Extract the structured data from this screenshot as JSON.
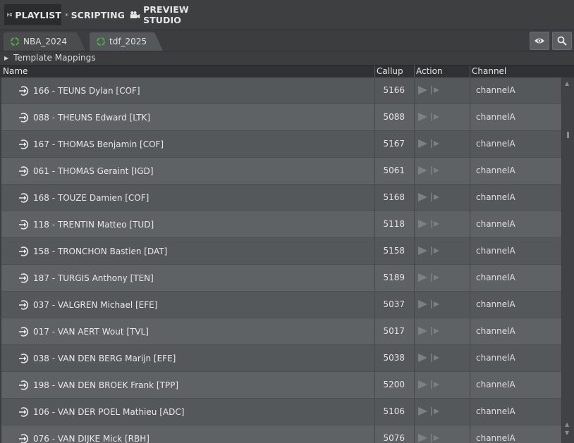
{
  "topbar": {
    "playlist_label": "PLAYLIST",
    "scripting_label": "SCRIPTING",
    "preview_label": "PREVIEW STUDIO"
  },
  "tabs": [
    {
      "label": "NBA_2024"
    },
    {
      "label": "tdf_2025"
    }
  ],
  "toolbar": {
    "eye_icon": "eye-icon",
    "search_icon": "search-icon"
  },
  "mappings": {
    "label": "Template Mappings"
  },
  "columns": {
    "name": "Name",
    "callup": "Callup",
    "action": "Action",
    "channel": "Channel"
  },
  "rows": [
    {
      "name": "166 - TEUNS Dylan  [COF]",
      "callup": "5166",
      "channel": "channelA"
    },
    {
      "name": "088 - THEUNS Edward  [LTK]",
      "callup": "5088",
      "channel": "channelA"
    },
    {
      "name": "167 - THOMAS Benjamin  [COF]",
      "callup": "5167",
      "channel": "channelA"
    },
    {
      "name": "061 - THOMAS Geraint  [IGD]",
      "callup": "5061",
      "channel": "channelA"
    },
    {
      "name": "168 - TOUZE Damien  [COF]",
      "callup": "5168",
      "channel": "channelA"
    },
    {
      "name": "118 - TRENTIN Matteo  [TUD]",
      "callup": "5118",
      "channel": "channelA"
    },
    {
      "name": "158 - TRONCHON Bastien  [DAT]",
      "callup": "5158",
      "channel": "channelA"
    },
    {
      "name": "187 - TURGIS Anthony  [TEN]",
      "callup": "5189",
      "channel": "channelA"
    },
    {
      "name": "037 - VALGREN Michael  [EFE]",
      "callup": "5037",
      "channel": "channelA"
    },
    {
      "name": "017 - VAN AERT Wout [TVL]",
      "callup": "5017",
      "channel": "channelA"
    },
    {
      "name": "038 - VAN DEN BERG Marijn  [EFE]",
      "callup": "5038",
      "channel": "channelA"
    },
    {
      "name": "198 - VAN DEN BROEK Frank  [TPP]",
      "callup": "5200",
      "channel": "channelA"
    },
    {
      "name": "106 - VAN DER POEL Mathieu [ADC]",
      "callup": "5106",
      "channel": "channelA"
    },
    {
      "name": "076 - VAN DIJKE Mick  [RBH]",
      "callup": "5076",
      "channel": "channelA"
    }
  ]
}
